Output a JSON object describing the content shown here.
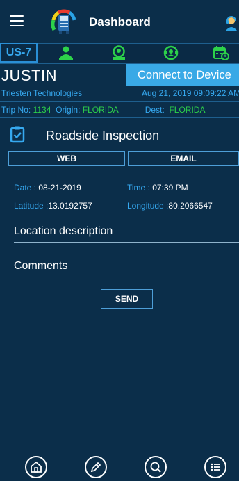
{
  "header": {
    "title": "Dashboard",
    "menu_icon": "hamburger-menu-icon",
    "logo_icon": "truck-gauge-logo",
    "agent_icon": "support-agent-icon"
  },
  "status_bar": {
    "cycle": "US-7",
    "icons": [
      "driver-icon",
      "sleeper-icon",
      "on-duty-icon",
      "calendar-clock-icon"
    ]
  },
  "driver": {
    "name": "JUSTIN",
    "company": "Triesten Technologies",
    "connect_label": "Connect to Device",
    "datetime": "Aug 21, 2019 09:09:22 AM"
  },
  "trip": {
    "trip_label": "Trip No:",
    "trip_no": "1134",
    "origin_label": "Origin:",
    "origin": "FLORIDA",
    "dest_label": "Dest:",
    "dest": "FLORIDA"
  },
  "page": {
    "title": "Roadside Inspection",
    "web_label": "WEB",
    "email_label": "EMAIL"
  },
  "info": {
    "date_label": "Date :",
    "date": "08-21-2019",
    "time_label": "Time :",
    "time": "07:39 PM",
    "lat_label": "Latitude :",
    "lat": "13.0192757",
    "lon_label": "Longitude :",
    "lon": "80.2066547"
  },
  "form": {
    "location_label": "Location description",
    "comments_label": "Comments",
    "send_label": "SEND"
  },
  "colors": {
    "background": "#0b2e4a",
    "accent": "#36a9f0",
    "connect_bg": "#39a9e6",
    "status_green": "#2dd24a"
  },
  "bottom_nav": [
    "home-icon",
    "edit-icon",
    "search-icon",
    "list-icon"
  ]
}
